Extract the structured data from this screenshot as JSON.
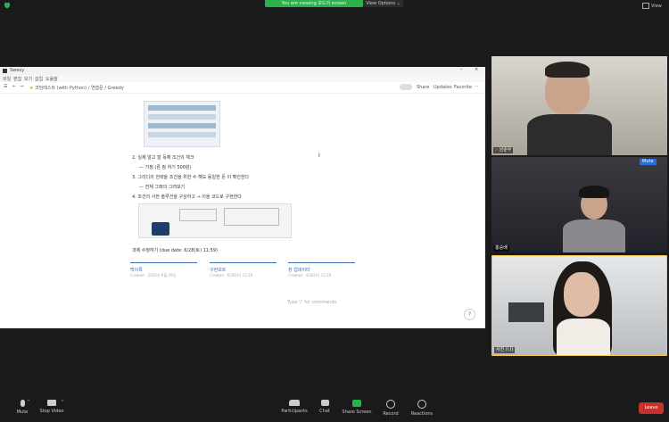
{
  "top": {
    "share_banner": "You are viewing 보드의 screen",
    "view_options": "View Options ⌄",
    "view_label": "View"
  },
  "shared_window": {
    "title": "Swexy",
    "menu": [
      "파일",
      "편집",
      "보기",
      "삽입",
      "도움말"
    ],
    "breadcrumb": [
      "코딩테스트 (with Python)",
      "연습문",
      "Greedy"
    ],
    "toolbar_right": [
      "Share",
      "Updates",
      "Favorite"
    ],
    "lines": [
      "2. 실제 알고 잘 독해 조건의 체크",
      "— 가정 (른 참 하기 500원)",
      "3. 그리디의 전략을 조건을 위한 수 해도 동일한 돈 이 확인한다",
      "— 전체 그래의 그려보기",
      "4. 조건의 사한 솔루션을 구상하고 → 이을 코드로 구현한다"
    ],
    "due_text": "과제 수정하기 (due date: 6/28(토) 11:59)",
    "cards": [
      {
        "title": "백의록",
        "sub": "Created · 2024년 6월 29일"
      },
      {
        "title": "구현보트",
        "sub": "Created · 6/28(토) 11:59"
      },
      {
        "title": "창 업데이터",
        "sub": "Created · 4/28(토) 11:59"
      }
    ],
    "comment_placeholder": "Type '/' for commands",
    "help": "?"
  },
  "participants": [
    {
      "name": "남순우"
    },
    {
      "name": "홍승배",
      "badge": "Mute"
    },
    {
      "name": "서진 (나)"
    }
  ],
  "controls": [
    {
      "label": "Mute",
      "icon": "microphone-icon"
    },
    {
      "label": "Stop Video",
      "icon": "video-camera-icon"
    },
    {
      "label": "Participants",
      "icon": "participants-icon",
      "count": "3"
    },
    {
      "label": "Chat",
      "icon": "chat-icon"
    },
    {
      "label": "Share Screen",
      "icon": "share-screen-icon"
    },
    {
      "label": "Record",
      "icon": "record-icon"
    },
    {
      "label": "Reactions",
      "icon": "reactions-icon"
    }
  ],
  "leave_label": "Leave",
  "colors": {
    "accent_green": "#2bb24c",
    "leave_red": "#c5322b",
    "active_speaker": "#f2c94c"
  }
}
